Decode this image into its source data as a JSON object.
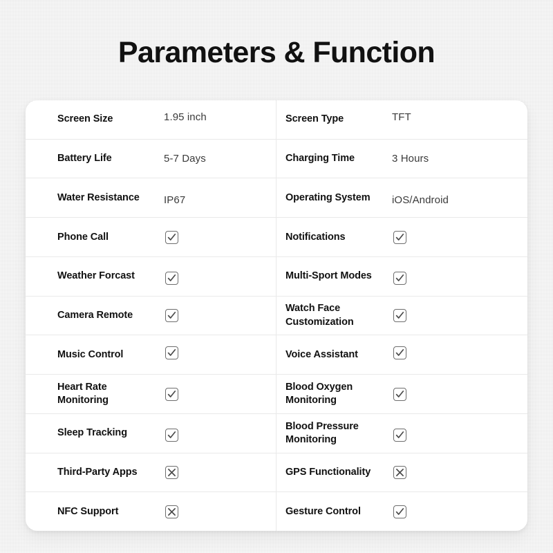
{
  "page": {
    "title": "Parameters & Function",
    "background_color": "#f1f1f1",
    "card_color": "#ffffff"
  },
  "table": {
    "checked_icon": "checkbox-checked-icon",
    "unchecked_icon": "checkbox-crossed-icon",
    "rows": [
      {
        "left": {
          "label": "Screen Size",
          "value": "1.95 inch",
          "type": "text"
        },
        "right": {
          "label": "Screen Type",
          "value": "TFT",
          "type": "text"
        }
      },
      {
        "left": {
          "label": "Battery Life",
          "value": "5-7 Days",
          "type": "text"
        },
        "right": {
          "label": "Charging Time",
          "value": "3 Hours",
          "type": "text"
        }
      },
      {
        "left": {
          "label": "Water Resistance",
          "value": "IP67",
          "type": "text"
        },
        "right": {
          "label": "Operating System",
          "value": "iOS/Android",
          "type": "text"
        }
      },
      {
        "left": {
          "label": "Phone Call",
          "value": "check",
          "type": "mark"
        },
        "right": {
          "label": "Notifications",
          "value": "check",
          "type": "mark"
        }
      },
      {
        "left": {
          "label": "Weather Forcast",
          "value": "check",
          "type": "mark"
        },
        "right": {
          "label": "Multi-Sport Modes",
          "value": "check",
          "type": "mark"
        }
      },
      {
        "left": {
          "label": "Camera Remote",
          "value": "check",
          "type": "mark"
        },
        "right": {
          "label": "Watch Face Customization",
          "value": "check",
          "type": "mark"
        }
      },
      {
        "left": {
          "label": "Music Control",
          "value": "check",
          "type": "mark"
        },
        "right": {
          "label": "Voice Assistant",
          "value": "check",
          "type": "mark"
        }
      },
      {
        "left": {
          "label": "Heart Rate Monitoring",
          "value": "check",
          "type": "mark"
        },
        "right": {
          "label": "Blood Oxygen Monitoring",
          "value": "check",
          "type": "mark"
        }
      },
      {
        "left": {
          "label": "Sleep Tracking",
          "value": "check",
          "type": "mark"
        },
        "right": {
          "label": "Blood Pressure Monitoring",
          "value": "check",
          "type": "mark"
        }
      },
      {
        "left": {
          "label": "Third-Party Apps",
          "value": "cross",
          "type": "mark"
        },
        "right": {
          "label": "GPS Functionality",
          "value": "cross",
          "type": "mark"
        }
      },
      {
        "left": {
          "label": "NFC Support",
          "value": "cross",
          "type": "mark"
        },
        "right": {
          "label": "Gesture Control",
          "value": "check",
          "type": "mark"
        }
      }
    ]
  }
}
